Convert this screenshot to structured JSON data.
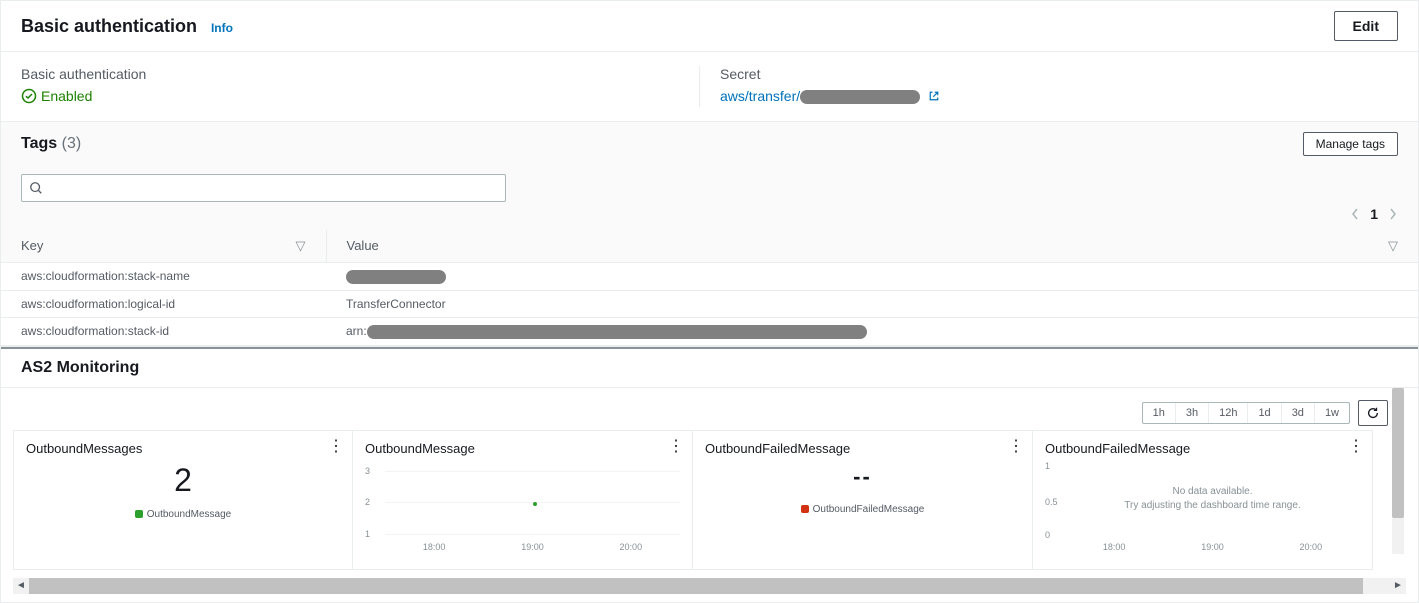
{
  "basic_auth": {
    "title": "Basic authentication",
    "info_label": "Info",
    "edit_label": "Edit",
    "field_label": "Basic authentication",
    "status_label": "Enabled",
    "secret_label": "Secret",
    "secret_prefix": "aws/transfer/"
  },
  "tags": {
    "title": "Tags",
    "count_label": "(3)",
    "manage_label": "Manage tags",
    "search_placeholder": "",
    "page_current": "1",
    "columns": {
      "key": "Key",
      "value": "Value"
    },
    "rows": [
      {
        "key": "aws:cloudformation:stack-name",
        "value": "",
        "redacted": "w2"
      },
      {
        "key": "aws:cloudformation:logical-id",
        "value": "TransferConnector"
      },
      {
        "key": "aws:cloudformation:stack-id",
        "value_prefix": "arn:",
        "redacted": "w3"
      }
    ]
  },
  "monitoring": {
    "title": "AS2 Monitoring",
    "ranges": [
      "1h",
      "3h",
      "12h",
      "1d",
      "3d",
      "1w"
    ],
    "charts": [
      {
        "title": "OutboundMessages",
        "kind": "number",
        "value": "2",
        "legend": "OutboundMessage",
        "legend_color": "green"
      },
      {
        "title": "OutboundMessage",
        "kind": "line",
        "legend_color": "green"
      },
      {
        "title": "OutboundFailedMessage",
        "kind": "dash",
        "legend": "OutboundFailedMessage",
        "legend_color": "red"
      },
      {
        "title": "OutboundFailedMessage",
        "kind": "empty"
      }
    ]
  },
  "chart_data": [
    {
      "type": "number",
      "title": "OutboundMessages",
      "value": 2,
      "series_name": "OutboundMessage"
    },
    {
      "type": "line",
      "title": "OutboundMessage",
      "x": [
        "18:00",
        "19:00",
        "20:00"
      ],
      "yticks": [
        1.0,
        2.0,
        3.0
      ],
      "ylim": [
        1.0,
        3.0
      ],
      "series": [
        {
          "name": "OutboundMessage",
          "points": [
            {
              "x": "19:00",
              "y": 2.0
            }
          ]
        }
      ]
    },
    {
      "type": "number",
      "title": "OutboundFailedMessage",
      "value": null,
      "display": "--",
      "series_name": "OutboundFailedMessage"
    },
    {
      "type": "line",
      "title": "OutboundFailedMessage",
      "x": [
        "18:00",
        "19:00",
        "20:00"
      ],
      "yticks": [
        0,
        0.5,
        1.0
      ],
      "ylim": [
        0,
        1.0
      ],
      "series": [],
      "nodata_line1": "No data available.",
      "nodata_line2": "Try adjusting the dashboard time range."
    }
  ]
}
